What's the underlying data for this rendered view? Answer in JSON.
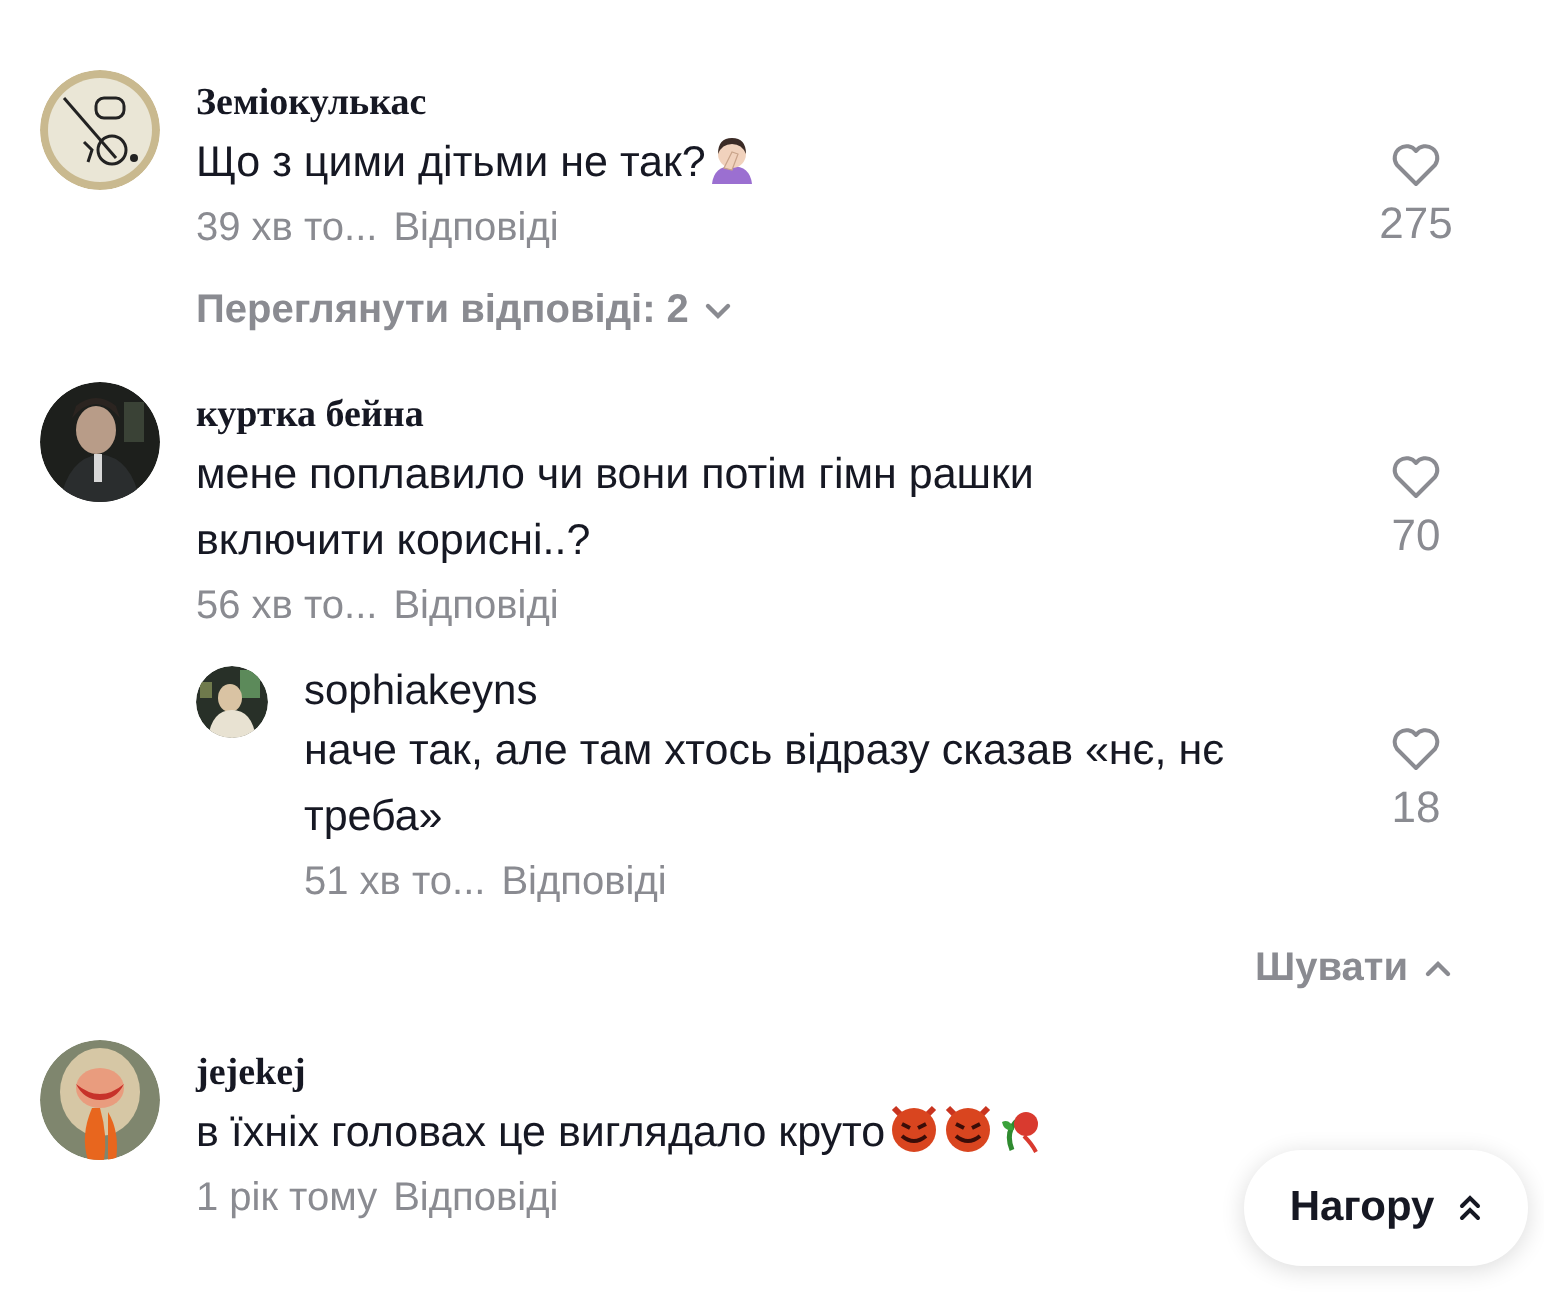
{
  "comments": [
    {
      "author": "Земіокулькас",
      "avatar": {
        "kind": "sketch"
      },
      "text": "Що з цими дітьми не так?",
      "emoji": [
        {
          "kind": "facepalm"
        }
      ],
      "time": "39 хв то...",
      "reply_label": "Відповіді",
      "likes": "275",
      "replies_toggle": {
        "label": "Переглянути відповіді: 2",
        "expanded": false
      }
    },
    {
      "author": "куртка бейна",
      "avatar": {
        "kind": "dark"
      },
      "text": "мене поплавило чи вони потім гімн рашки включити корисні..?",
      "time": "56 хв то...",
      "reply_label": "Відповіді",
      "likes": "70",
      "replies": [
        {
          "author": "sophiakeyns",
          "avatar": {
            "kind": "night"
          },
          "text": "наче так, але там хтось відразу сказав «нє, нє треба»",
          "time": "51 хв то...",
          "reply_label": "Відповіді",
          "likes": "18"
        }
      ],
      "replies_toggle": {
        "label": "Шувати",
        "expanded": true
      }
    },
    {
      "author": "jejekej",
      "avatar": {
        "kind": "blonde"
      },
      "text": "в їхніх головах це виглядало круто",
      "emoji": [
        {
          "kind": "devil"
        },
        {
          "kind": "devil"
        },
        {
          "kind": "rose"
        }
      ],
      "time": "1 рік тому",
      "reply_label": "Відповіді"
    }
  ],
  "back_to_top": {
    "label": "Нагору"
  }
}
